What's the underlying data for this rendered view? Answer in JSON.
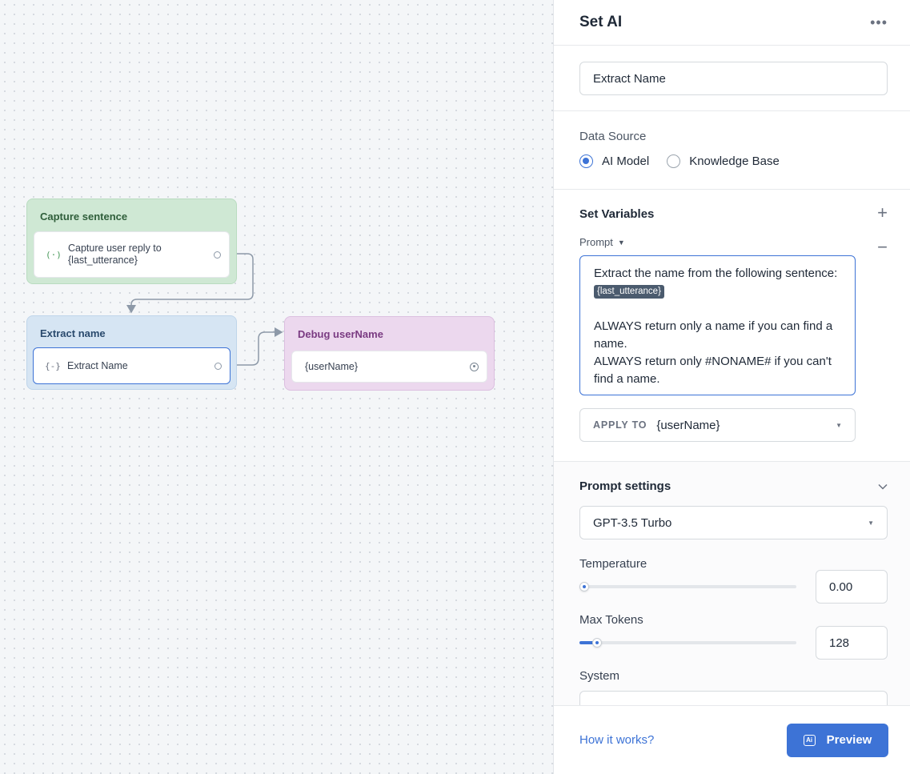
{
  "canvas": {
    "blocks": [
      {
        "title": "Capture sentence",
        "step": {
          "icon": "capture-icon",
          "glyph": "(·)",
          "text": "Capture user reply to {last_utterance}"
        }
      },
      {
        "title": "Extract name",
        "step": {
          "icon": "set-ai-icon",
          "glyph": "{-}",
          "text": "Extract Name"
        }
      },
      {
        "title": "Debug userName",
        "step": {
          "icon": "text-icon",
          "text": "{userName}"
        }
      }
    ]
  },
  "panel": {
    "title": "Set AI",
    "more_glyph": "•••",
    "step_name": "Extract Name",
    "data_source": {
      "label": "Data Source",
      "options": [
        "AI Model",
        "Knowledge Base"
      ],
      "selected": "AI Model"
    },
    "variables": {
      "label": "Set Variables",
      "add_glyph": "+",
      "remove_glyph": "−",
      "prompt_label": "Prompt",
      "prompt_line1": "Extract the name from the following sentence:",
      "prompt_chip": "{last_utterance}",
      "prompt_line2": "ALWAYS return only a name if you can find a name.",
      "prompt_line3": "ALWAYS return only #NONAME# if you can't find a name.",
      "apply_label": "APPLY TO",
      "apply_value": "{userName}"
    },
    "prompt_settings": {
      "label": "Prompt settings",
      "model": "GPT-3.5 Turbo",
      "temperature_label": "Temperature",
      "temperature_value": "0.00",
      "temperature_fraction": 0.0,
      "max_tokens_label": "Max Tokens",
      "max_tokens_value": "128",
      "max_tokens_fraction": 0.06,
      "system_label": "System"
    },
    "footer": {
      "help_link": "How it works?",
      "preview_label": "Preview",
      "preview_icon_text": "Ai"
    }
  },
  "colors": {
    "accent": "#3d73d6",
    "capture_block": "#cfe8d4",
    "extract_block": "#d6e5f3",
    "debug_block": "#ecd8ee"
  }
}
